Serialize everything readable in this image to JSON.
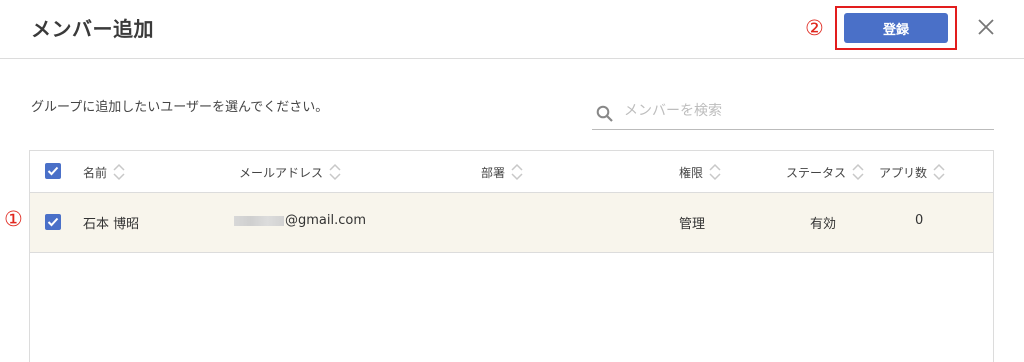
{
  "dialog": {
    "title": "メンバー追加",
    "register_label": "登録",
    "instruction": "グループに追加したいユーザーを選んでください。"
  },
  "markers": {
    "one": "①",
    "two": "②"
  },
  "search": {
    "placeholder": "メンバーを検索",
    "value": ""
  },
  "table": {
    "columns": {
      "name": "名前",
      "email": "メールアドレス",
      "department": "部署",
      "role": "権限",
      "status": "ステータス",
      "apps": "アプリ数"
    },
    "rows": [
      {
        "checked": true,
        "name": "石本 博昭",
        "email_domain": "@gmail.com",
        "department": "",
        "role": "管理",
        "status": "有効",
        "apps": "0"
      }
    ]
  },
  "colors": {
    "accent": "#4a70c8",
    "highlight": "#e21d1d",
    "selected_row": "#f8f5ec"
  },
  "icons": [
    "close-icon",
    "search-icon",
    "sort-icon",
    "checkbox-checked-icon"
  ]
}
